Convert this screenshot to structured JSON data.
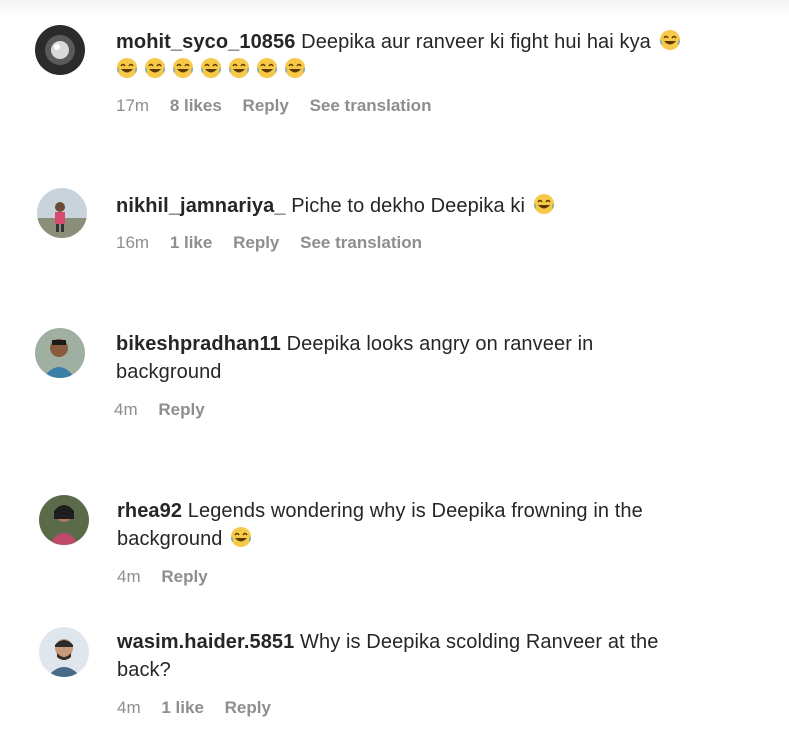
{
  "comments": [
    {
      "username": "mohit_syco_10856",
      "text": "Deepika aur ranveer ki fight hui hai kya",
      "emoji": "face-with-tears-of-joy",
      "emoji_count": 8,
      "time": "17m",
      "likes": "8 likes",
      "reply": "Reply",
      "translate": "See translation"
    },
    {
      "username": "nikhil_jamnariya_",
      "text": "Piche to dekho Deepika ki",
      "emoji": "face-with-tears-of-joy",
      "emoji_count": 1,
      "time": "16m",
      "likes": "1 like",
      "reply": "Reply",
      "translate": "See translation"
    },
    {
      "username": "bikeshpradhan11",
      "text": "Deepika looks angry on ranveer in background",
      "emoji_count": 0,
      "time": "4m",
      "reply": "Reply"
    },
    {
      "username": "rhea92",
      "text": "Legends wondering why is Deepika frowning in the background",
      "emoji": "face-with-tears-of-joy",
      "emoji_count": 1,
      "time": "4m",
      "reply": "Reply"
    },
    {
      "username": "wasim.haider.5851",
      "text": "Why is Deepika scolding Ranveer at the back?",
      "emoji_count": 0,
      "time": "4m",
      "likes": "1 like",
      "reply": "Reply"
    }
  ],
  "colors": {
    "text": "#262626",
    "secondary": "#8e8e8e",
    "emoji_face": "#f7c948",
    "emoji_tears": "#4aa3df"
  }
}
